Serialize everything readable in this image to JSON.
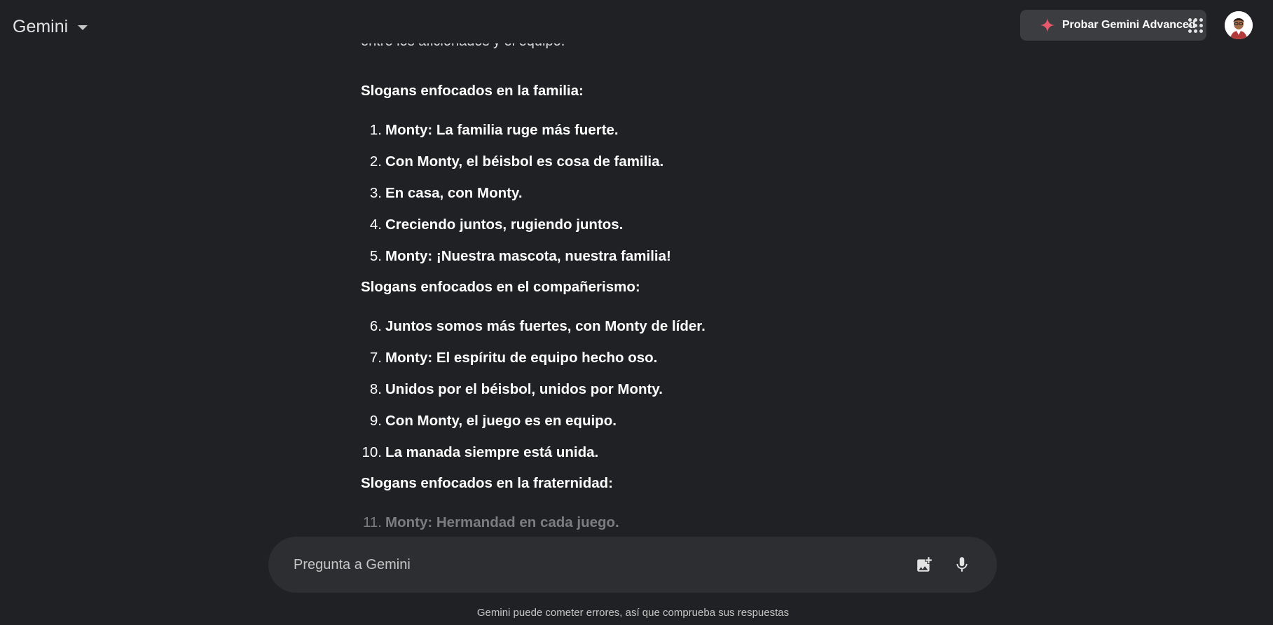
{
  "header": {
    "app_name": "Gemini",
    "upgrade_label": "Probar Gemini Advanced",
    "icons": {
      "brand_caret": "caret-down-icon",
      "upgrade": "sparkle-icon",
      "apps": "apps-grid-icon",
      "avatar": "user-avatar"
    }
  },
  "conversation": {
    "partial_text": "entre los aficionados y el equipo.",
    "sections": [
      {
        "heading": "Slogans enfocados en la familia:",
        "items": [
          {
            "num": "1.",
            "text": "Monty: La familia ruge más fuerte."
          },
          {
            "num": "2.",
            "text": "Con Monty, el béisbol es cosa de familia."
          },
          {
            "num": "3.",
            "text": "En casa, con Monty."
          },
          {
            "num": "4.",
            "text": "Creciendo juntos, rugiendo juntos."
          },
          {
            "num": "5.",
            "text": "Monty: ¡Nuestra mascota, nuestra familia!"
          }
        ]
      },
      {
        "heading": "Slogans enfocados en el compañerismo:",
        "items": [
          {
            "num": "6.",
            "text": "Juntos somos más fuertes, con Monty de líder."
          },
          {
            "num": "7.",
            "text": "Monty: El espíritu de equipo hecho oso."
          },
          {
            "num": "8.",
            "text": "Unidos por el béisbol, unidos por Monty."
          },
          {
            "num": "9.",
            "text": "Con Monty, el juego es en equipo."
          },
          {
            "num": "10.",
            "text": "La manada siempre está unida."
          }
        ]
      },
      {
        "heading": "Slogans enfocados en la fraternidad:",
        "items": [
          {
            "num": "11.",
            "text": "Monty: Hermandad en cada juego."
          }
        ]
      }
    ]
  },
  "input": {
    "placeholder": "Pregunta a Gemini",
    "value": "",
    "icons": {
      "image": "add-image-icon",
      "mic": "microphone-icon"
    }
  },
  "footer": {
    "disclaimer": "Gemini puede cometer errores, así que comprueba sus respuestas"
  },
  "colors": {
    "background": "#202124",
    "input_bg": "#2d2e31",
    "upgrade_bg": "#3c3d40",
    "sparkle": "#e8576a",
    "text": "#ffffff",
    "muted": "#c4c7c5"
  }
}
